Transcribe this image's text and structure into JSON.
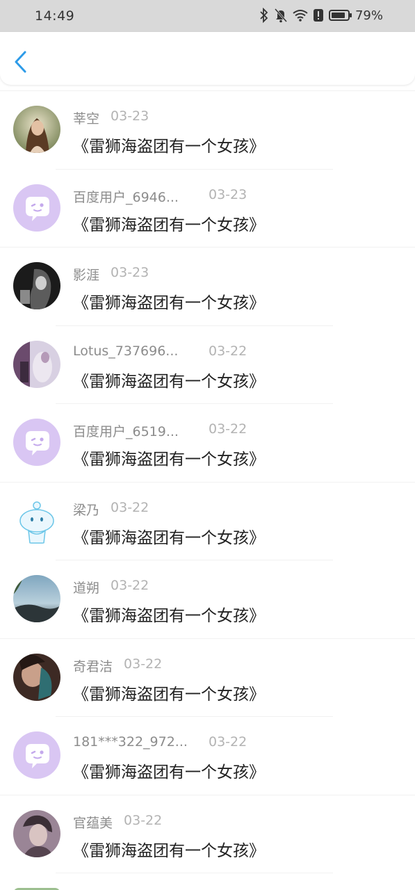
{
  "status_bar": {
    "time": "14:49",
    "battery": "79%",
    "icons": [
      "bluetooth-icon",
      "mute-bell-icon",
      "wifi-icon",
      "alert-icon",
      "battery-icon"
    ]
  },
  "header": {
    "back_icon": "chevron-left-icon",
    "accent_color": "#2d9be8"
  },
  "items": [
    {
      "name": "莘空",
      "date": "03-23",
      "title": "《雷狮海盗团有一个女孩》",
      "avatar": "photo-girl"
    },
    {
      "name": "百度用户_6946...",
      "date": "03-23",
      "title": "《雷狮海盗团有一个女孩》",
      "avatar": "default-purple"
    },
    {
      "name": "影涯",
      "date": "03-23",
      "title": "《雷狮海盗团有一个女孩》",
      "avatar": "photo-dark"
    },
    {
      "name": "Lotus_737696...",
      "date": "03-22",
      "title": "《雷狮海盗团有一个女孩》",
      "avatar": "photo-anime"
    },
    {
      "name": "百度用户_6519...",
      "date": "03-22",
      "title": "《雷狮海盗团有一个女孩》",
      "avatar": "default-purple"
    },
    {
      "name": "梁乃",
      "date": "03-22",
      "title": "《雷狮海盗团有一个女孩》",
      "avatar": "cartoon-blue"
    },
    {
      "name": "道朔",
      "date": "03-22",
      "title": "《雷狮海盗团有一个女孩》",
      "avatar": "photo-landscape"
    },
    {
      "name": "奇君洁",
      "date": "03-22",
      "title": "《雷狮海盗团有一个女孩》",
      "avatar": "photo-teal"
    },
    {
      "name": "181***322_972...",
      "date": "03-22",
      "title": "《雷狮海盗团有一个女孩》",
      "avatar": "default-purple"
    },
    {
      "name": "官蕴美",
      "date": "03-22",
      "title": "《雷狮海盗团有一个女孩》",
      "avatar": "photo-boy"
    }
  ]
}
